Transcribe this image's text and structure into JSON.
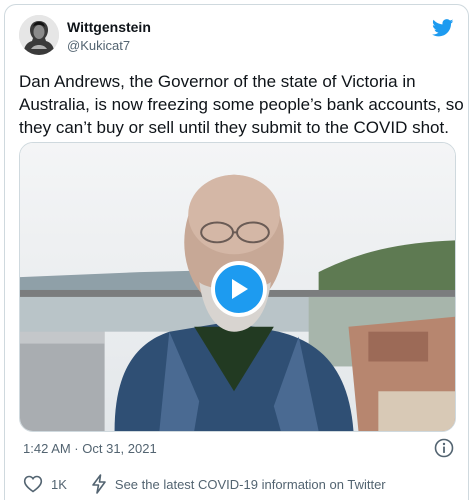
{
  "author": {
    "display_name": "Wittgenstein",
    "handle": "@Kukicat7",
    "avatar_icon": "portrait-avatar"
  },
  "brand": {
    "icon": "twitter-bird-icon",
    "color": "#1d9bf0"
  },
  "tweet": {
    "text": "Dan Andrews, the Governor of the state of Victoria in Australia, is now freezing some people’s bank accounts, so they can’t buy or sell until they submit to the COVID shot."
  },
  "media": {
    "type": "video",
    "play_icon": "play-icon"
  },
  "meta": {
    "timestamp": "1:42 AM · Oct 31, 2021",
    "info_icon": "info-icon"
  },
  "actions": {
    "like_icon": "heart-icon",
    "like_count": "1K",
    "covid_icon": "lightning-bolt-icon",
    "covid_label": "See the latest COVID-19 information on Twitter"
  }
}
